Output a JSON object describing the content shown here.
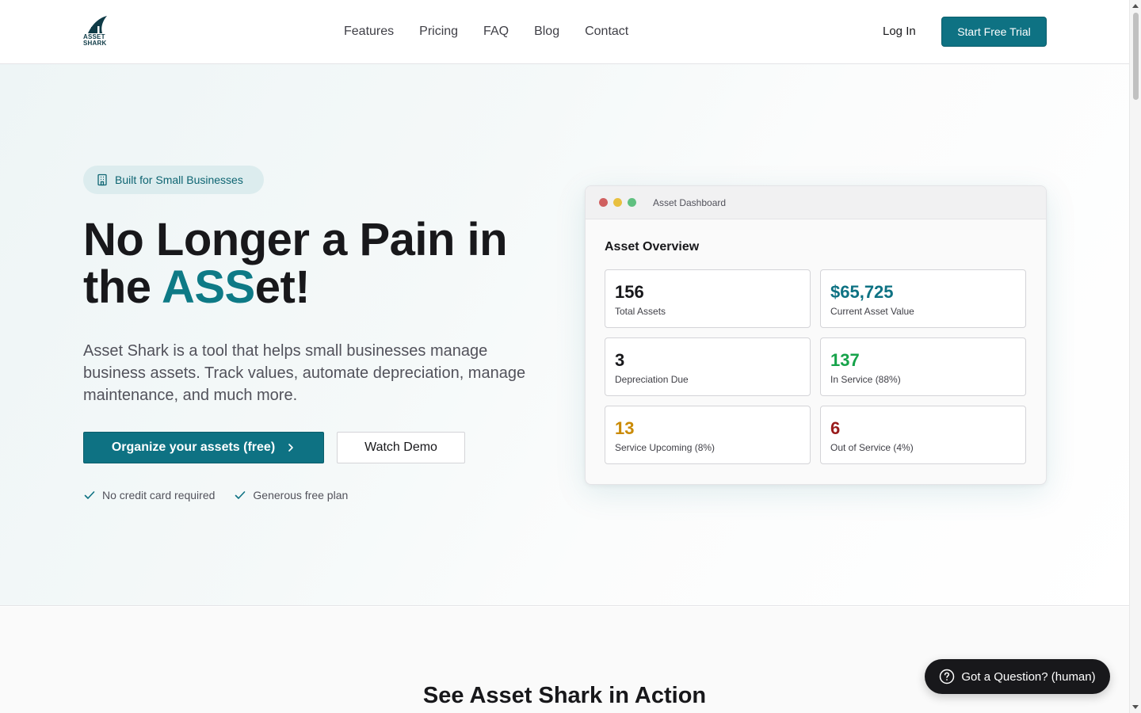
{
  "brand": {
    "logo_line1": "ASSET",
    "logo_line2": "SHARK"
  },
  "nav": {
    "links": [
      "Features",
      "Pricing",
      "FAQ",
      "Blog",
      "Contact"
    ],
    "login": "Log In",
    "trial": "Start Free Trial"
  },
  "hero": {
    "badge": "Built for Small Businesses",
    "headline_part1": "No Longer a Pain in the ",
    "headline_accent": "ASS",
    "headline_part2": "et!",
    "subtext": "Asset Shark is a tool that helps small businesses manage business assets. Track values, automate depreciation, manage maintenance, and much more.",
    "cta_primary": "Organize your assets (free)",
    "cta_secondary": "Watch Demo",
    "checks": [
      "No credit card required",
      "Generous free plan"
    ]
  },
  "dashboard": {
    "window_title": "Asset Dashboard",
    "heading": "Asset Overview",
    "stats": [
      {
        "value": "156",
        "label": "Total Assets",
        "color": "#18181b"
      },
      {
        "value": "$65,725",
        "label": "Current Asset Value",
        "color": "#0e7283"
      },
      {
        "value": "3",
        "label": "Depreciation Due",
        "color": "#18181b"
      },
      {
        "value": "137",
        "label": "In Service (88%)",
        "color": "#16a34a"
      },
      {
        "value": "13",
        "label": "Service Upcoming (8%)",
        "color": "#ca8a04"
      },
      {
        "value": "6",
        "label": "Out of Service (4%)",
        "color": "#991b1b"
      }
    ],
    "dot_colors": [
      "#d06060",
      "#e8c040",
      "#60c080"
    ]
  },
  "lower": {
    "title": "See Asset Shark in Action"
  },
  "chat": {
    "label": "Got a Question? (human)"
  },
  "colors": {
    "accent": "#0e7283",
    "text": "#18181b"
  }
}
